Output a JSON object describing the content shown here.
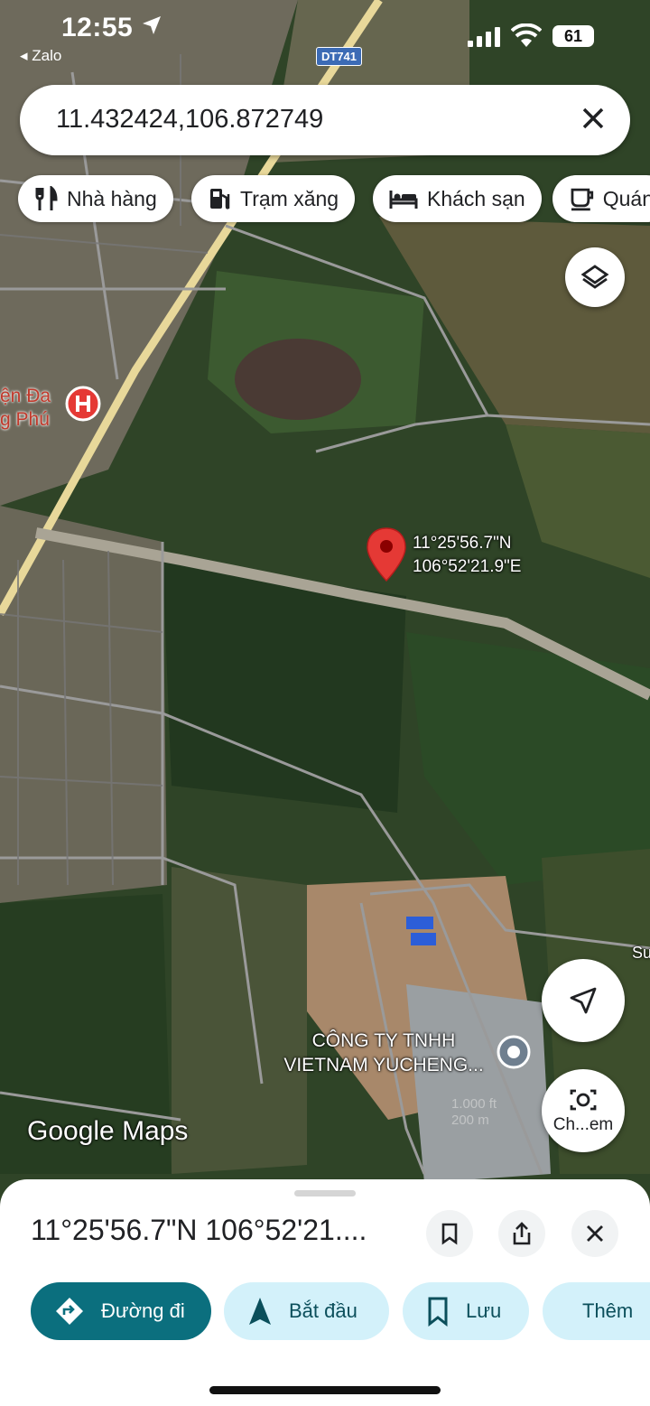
{
  "status_bar": {
    "time": "12:55",
    "back_app": "◂ Zalo",
    "battery": "61"
  },
  "map": {
    "road_shield": "DT741",
    "hospital_label_line1": "ện Đa",
    "hospital_label_line2": "g Phú",
    "pin_lat": "11°25'56.7\"N",
    "pin_lng": "106°52'21.9\"E",
    "poi_line1": "CÔNG TY TNHH",
    "poi_line2": "VIETNAM YUCHENG...",
    "logo": "Google Maps",
    "scale_ft": "1.000 ft",
    "scale_m": "200 m",
    "edge_label": "Su",
    "lens_label": "Ch...em"
  },
  "search": {
    "query": "11.432424,106.872749"
  },
  "chips": [
    {
      "label": "Nhà hàng",
      "icon": "restaurant-icon"
    },
    {
      "label": "Trạm xăng",
      "icon": "gas-station-icon"
    },
    {
      "label": "Khách sạn",
      "icon": "hotel-icon"
    },
    {
      "label": "Quán",
      "icon": "cafe-icon"
    }
  ],
  "sheet": {
    "title": "11°25'56.7\"N 106°52'21...."
  },
  "actions": [
    {
      "label": "Đường đi",
      "icon": "directions-icon"
    },
    {
      "label": "Bắt đầu",
      "icon": "navigation-icon"
    },
    {
      "label": "Lưu",
      "icon": "bookmark-icon"
    },
    {
      "label": "Thêm",
      "icon": "flag-icon"
    }
  ],
  "colors": {
    "primary_action": "#0b6f7e",
    "secondary_action": "#d3f1fa",
    "pin": "#e53935"
  }
}
